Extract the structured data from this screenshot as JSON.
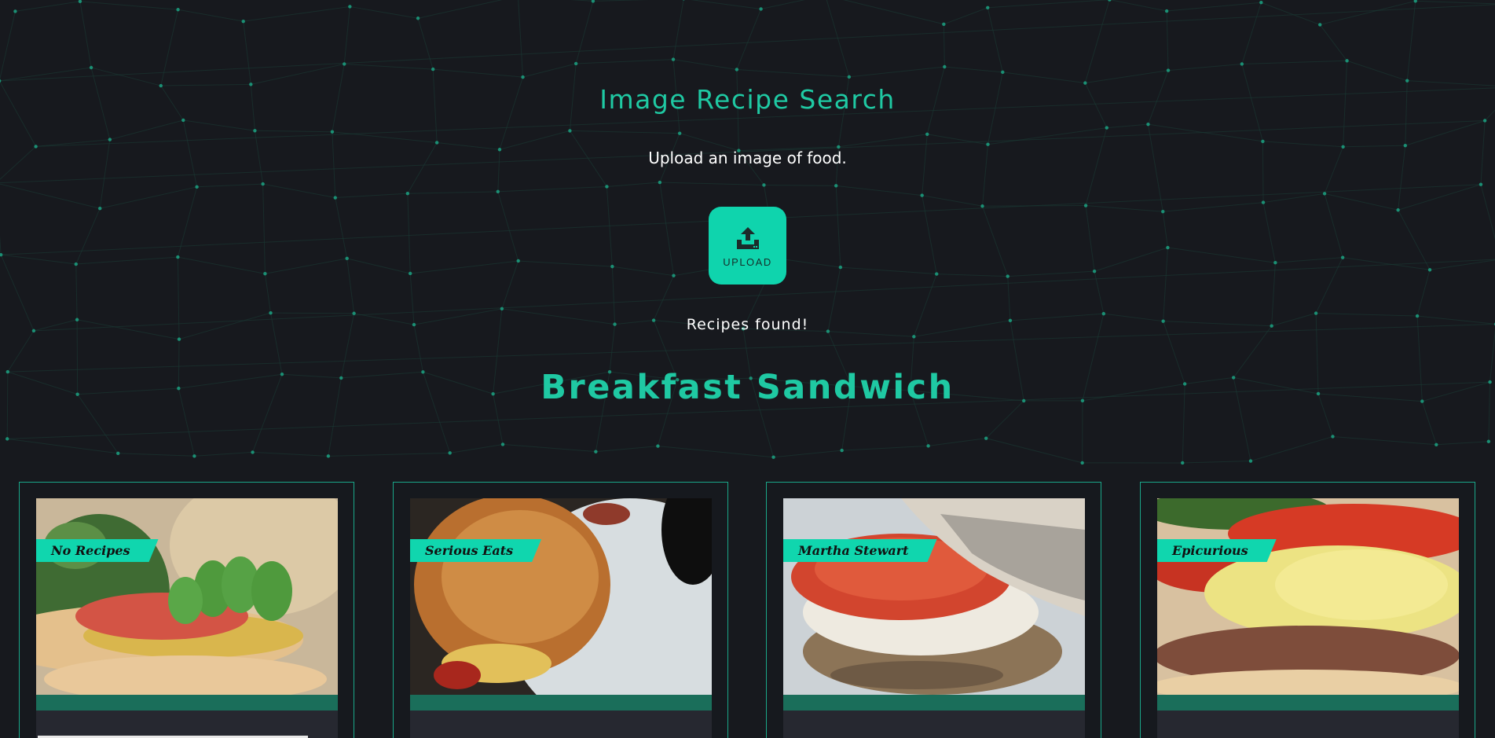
{
  "header": {
    "title": "Image Recipe Search",
    "subtitle": "Upload an image of food."
  },
  "upload": {
    "label": "UPLOAD",
    "icon": "upload-icon"
  },
  "results": {
    "status": "Recipes found!",
    "dish_name": "Breakfast Sandwich",
    "cards": [
      {
        "source": "No Recipes",
        "image": "sandwich-with-cucumber-salmon-greens"
      },
      {
        "source": "Serious Eats",
        "image": "egg-sandwich-on-plate"
      },
      {
        "source": "Martha Stewart",
        "image": "english-muffin-tomato-egg"
      },
      {
        "source": "Epicurious",
        "image": "scrambled-egg-sausage-sandwich"
      }
    ]
  },
  "colors": {
    "background": "#17191e",
    "accent": "#1fc9a3",
    "button": "#0fd4ad",
    "band": "#1a6e5a",
    "card_border": "#1aa789"
  }
}
